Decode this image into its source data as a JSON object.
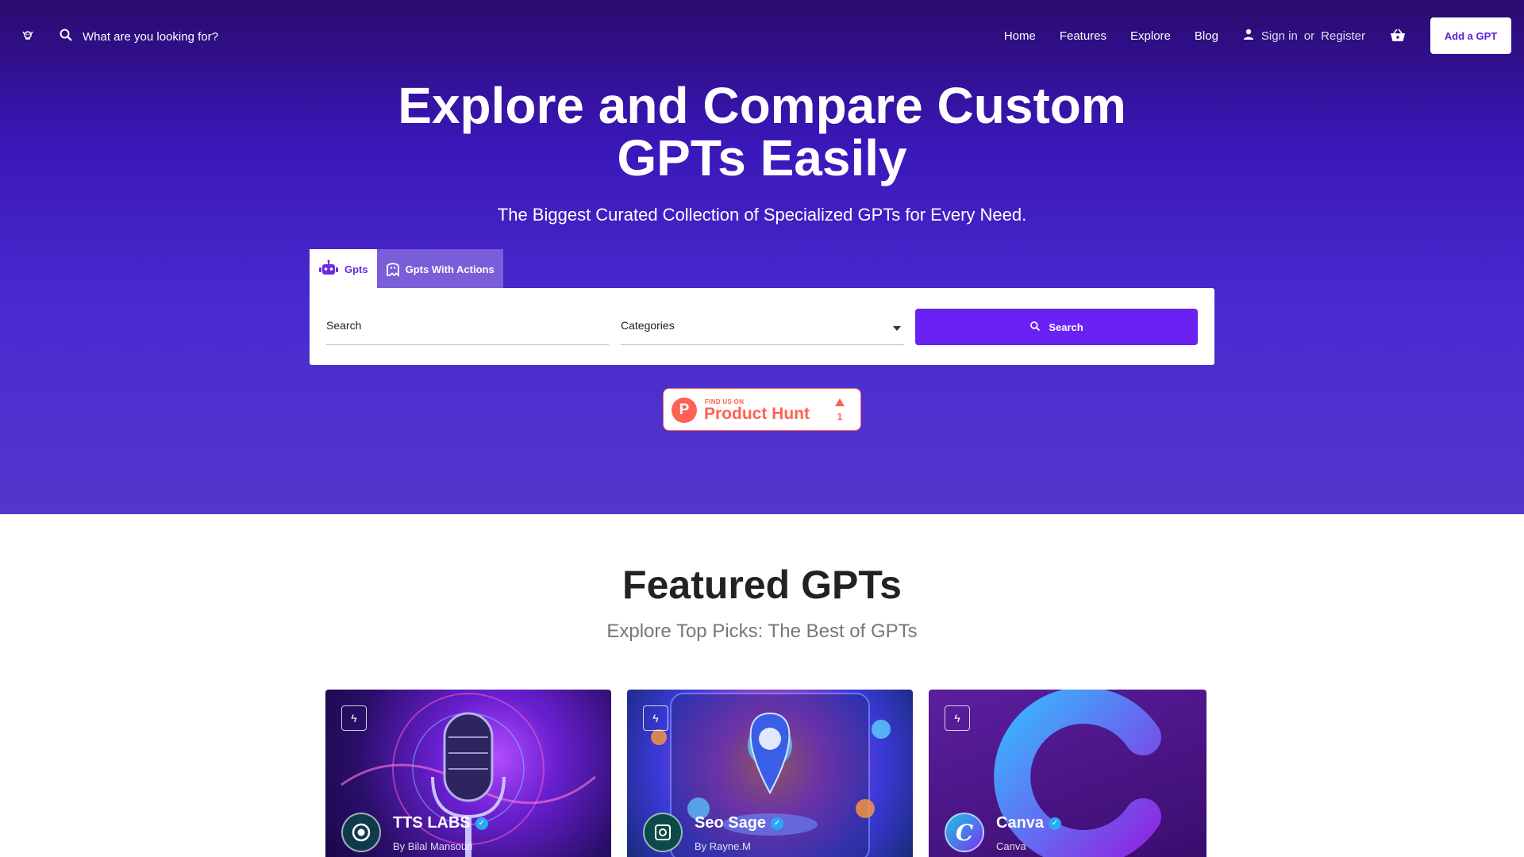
{
  "colors": {
    "hero_top": "#2a0b6e",
    "hero_bottom": "#5237cc",
    "accent": "#6a22f4",
    "product_hunt": "#ff6154",
    "verified": "#2aa8f2"
  },
  "nav": {
    "logo_icon": "robot-hand-icon",
    "search_placeholder": "What are you looking for?",
    "links": [
      "Home",
      "Features",
      "Explore",
      "Blog"
    ],
    "signin": "Sign in",
    "or": "or",
    "register": "Register",
    "cart_icon": "basket-icon",
    "add_gpt": "Add a GPT"
  },
  "hero": {
    "title_line1": "Explore and Compare Custom",
    "title_line2": "GPTs Easily",
    "subtitle": "The Biggest Curated Collection of Specialized GPTs for Every Need."
  },
  "search_panel": {
    "tabs": [
      {
        "label": "Gpts",
        "icon": "robot-icon",
        "active": true
      },
      {
        "label": "Gpts With Actions",
        "icon": "ghost-icon",
        "active": false
      }
    ],
    "search_label": "Search",
    "categories_label": "Categories",
    "search_button": "Search"
  },
  "product_hunt": {
    "small_text": "FIND US ON",
    "big_text": "Product Hunt",
    "logo_letter": "P",
    "upvotes": "1"
  },
  "featured": {
    "title": "Featured GPTs",
    "subtitle": "Explore Top Picks: The Best of GPTs",
    "cards": [
      {
        "name": "TTS LABS",
        "author": "By Bilal Mansouri",
        "verified": true,
        "icon": "microphone-icon"
      },
      {
        "name": "Seo Sage",
        "author": "By Rayne.M",
        "verified": true,
        "icon": "location-pin-icon"
      },
      {
        "name": "Canva",
        "author": "Canva",
        "verified": true,
        "icon": "canva-c-icon"
      }
    ]
  }
}
